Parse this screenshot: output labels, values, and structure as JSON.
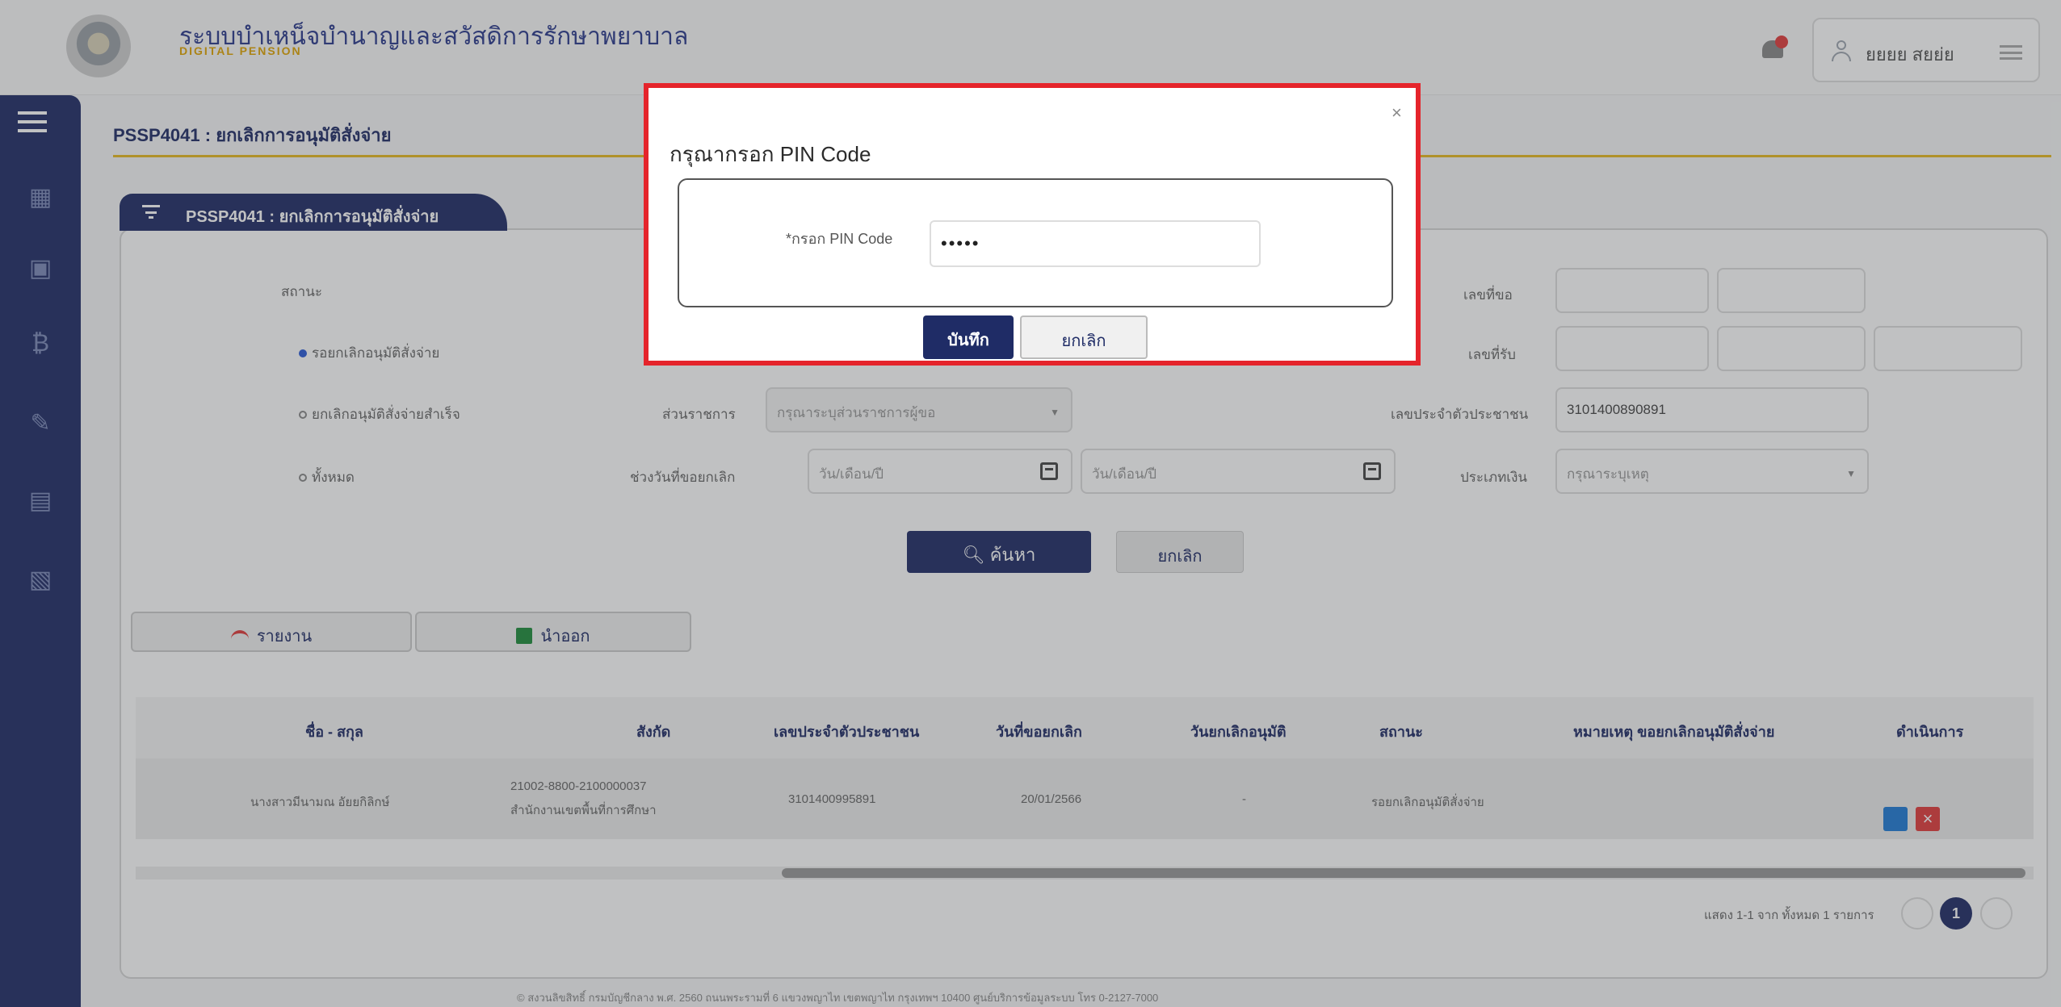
{
  "header": {
    "system_title": "ระบบบำเหน็จบำนาญและสวัสดิการรักษาพยาบาล",
    "system_subtitle": "DIGITAL PENSION",
    "user_name": "ยยยย สยย่ย"
  },
  "page": {
    "title": "PSSP4041 : ยกเลิกการอนุมัติสั่งจ่าย",
    "panel_tab": "PSSP4041 : ยกเลิกการอนุมัติสั่งจ่าย"
  },
  "filters": {
    "status_label": "สถานะ",
    "radios": [
      {
        "label": "รอยกเลิกอนุมัติสั่งจ่าย",
        "checked": true
      },
      {
        "label": "ยกเลิกอนุมัติสั่งจ่ายสำเร็จ",
        "checked": false
      },
      {
        "label": "ทั้งหมด",
        "checked": false
      }
    ],
    "agency_label": "ส่วนราชการ",
    "agency_placeholder": "กรุณาระบุส่วนราชการผู้ขอ",
    "date_range_label": "ช่วงวันที่ขอยกเลิก",
    "date_from_placeholder": "วัน/เดือน/ปี",
    "date_to_placeholder": "วัน/เดือน/ปี",
    "request_no_label": "เลขที่ขอ",
    "receipt_no_label": "เลขที่รับ",
    "citizen_id_label": "เลขประจำตัวประชาชน",
    "citizen_id_value": "3101400890891",
    "type_label": "ประเภทเงิน",
    "type_placeholder": "กรุณาระบุเหตุ",
    "search_button": "ค้นหา",
    "clear_button": "ยกเลิก"
  },
  "actions": {
    "report_button": "รายงาน",
    "export_button": "นำออก"
  },
  "table": {
    "headers": [
      "ชื่อ - สกุล",
      "สังกัด",
      "เลขประจำตัวประชาชน",
      "วันที่ขอยกเลิก",
      "วันยกเลิกอนุมัติ",
      "สถานะ",
      "หมายเหตุ ขอยกเลิกอนุมัติสั่งจ่าย",
      "ดำเนินการ"
    ],
    "rows": [
      {
        "name": "นางสาวมีนามณ อัยยกิลิกษ์",
        "agency_line1": "21002-8800-2100000037",
        "agency_line2": "สำนักงานเขตพื้นที่การศึกษา",
        "citizen_id": "3101400995891",
        "request_date": "20/01/2566",
        "cancel_date": "-",
        "status": "รอยกเลิกอนุมัติสั่งจ่าย"
      }
    ]
  },
  "pagination": {
    "summary": "แสดง 1-1 จาก ทั้งหมด 1 รายการ",
    "current_page": "1"
  },
  "footer": "© สงวนลิขสิทธิ์ กรมบัญชีกลาง พ.ศ. 2560 ถนนพระรามที่ 6 แขวงพญาไท เขตพญาไท กรุงเทพฯ 10400 ศูนย์บริการข้อมูลระบบ โทร 0-2127-7000",
  "modal": {
    "title": "กรุณากรอก PIN Code",
    "close_glyph": "×",
    "pin_label": "*กรอก PIN Code",
    "pin_value": "•••••",
    "save_button": "บันทึก",
    "cancel_button": "ยกเลิก",
    "highlight_color": "#e5242b"
  }
}
